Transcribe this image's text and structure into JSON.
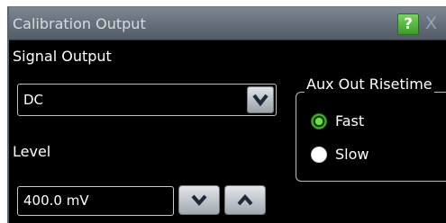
{
  "window": {
    "title": "Calibration Output",
    "help_label": "?",
    "close_label": "X"
  },
  "signal_output": {
    "label": "Signal Output",
    "selected_value": "DC"
  },
  "level": {
    "label": "Level",
    "value": "400.0 mV"
  },
  "aux_out_risetime": {
    "label": "Aux Out Risetime",
    "options": [
      {
        "label": "Fast",
        "selected": true
      },
      {
        "label": "Slow",
        "selected": false
      }
    ]
  },
  "icons": {
    "select_dropdown": "chevron-down-icon",
    "decrement": "chevron-down-icon",
    "increment": "chevron-up-icon",
    "help": "help-icon",
    "close": "close-icon"
  },
  "colors": {
    "background": "#000000",
    "titlebar": "#69737d",
    "help_button": "#4fae37",
    "radio_selected": "#4eb22f",
    "text": "#ffffff"
  }
}
